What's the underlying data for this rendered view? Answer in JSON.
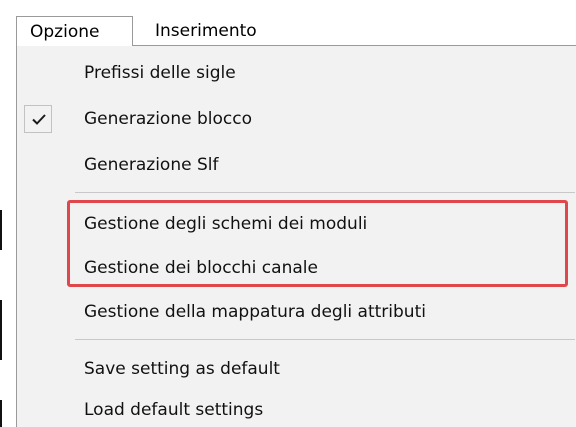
{
  "menubar": {
    "items": [
      {
        "label": "Opzione"
      },
      {
        "label": "Inserimento"
      }
    ]
  },
  "menu": {
    "items": [
      {
        "label": "Prefissi delle sigle",
        "checked": false
      },
      {
        "label": "Generazione blocco",
        "checked": true
      },
      {
        "label": "Generazione Slf",
        "checked": false
      },
      {
        "label": "Gestione degli schemi dei moduli",
        "checked": false
      },
      {
        "label": "Gestione dei blocchi canale",
        "checked": false
      },
      {
        "label": "Gestione della mappatura degli attributi",
        "checked": false
      },
      {
        "label": "Save setting as default",
        "checked": false
      },
      {
        "label": "Load default settings",
        "checked": false
      }
    ]
  },
  "colors": {
    "menu_background": "#f2f2f2",
    "highlight_border": "#e0474c",
    "border": "#9a9a9a"
  },
  "icons": {
    "check": "checkmark-icon"
  }
}
